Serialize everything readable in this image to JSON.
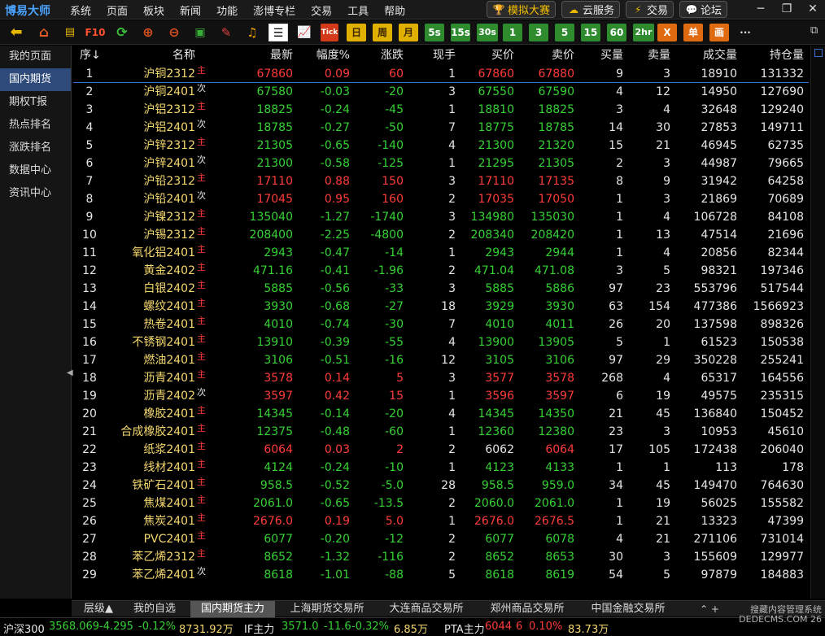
{
  "app": {
    "title": "博易大师"
  },
  "menu": [
    "系统",
    "页面",
    "板块",
    "新闻",
    "功能",
    "澎博专栏",
    "交易",
    "工具",
    "帮助"
  ],
  "quick_buttons": [
    {
      "label": "模拟大赛",
      "icon": "trophy-icon"
    },
    {
      "label": "云服务",
      "icon": "cloud-icon"
    },
    {
      "label": "交易",
      "icon": "lightning-icon"
    },
    {
      "label": "论坛",
      "icon": "chat-bubble-icon"
    }
  ],
  "toolbar": {
    "f10": "F10",
    "tick": "Tick",
    "periods": [
      "日",
      "周",
      "月",
      "5s",
      "15s",
      "30s",
      "1",
      "3",
      "5",
      "15",
      "60",
      "2hr"
    ],
    "x_label": "X",
    "dan": "单",
    "hua": "画",
    "more": "···"
  },
  "sidebar": {
    "items": [
      "我的页面",
      "国内期货",
      "期权T报",
      "热点排名",
      "涨跌排名",
      "数据中心",
      "资讯中心"
    ],
    "active_index": 1
  },
  "table": {
    "headers": [
      "序↓",
      "名称",
      "最新",
      "幅度%",
      "涨跌",
      "现手",
      "买价",
      "卖价",
      "买量",
      "卖量",
      "成交量",
      "持仓量"
    ],
    "tags": {
      "main": "主",
      "sub": "次"
    },
    "rows": [
      [
        "1",
        "沪铜2312",
        "main",
        "67860",
        "0.09",
        "60",
        "1",
        "67860",
        "67880",
        "9",
        "3",
        "18910",
        "131332",
        "up"
      ],
      [
        "2",
        "沪铜2401",
        "sub",
        "67580",
        "-0.03",
        "-20",
        "3",
        "67550",
        "67590",
        "4",
        "12",
        "14950",
        "127690",
        "dn"
      ],
      [
        "3",
        "沪铝2312",
        "main",
        "18825",
        "-0.24",
        "-45",
        "1",
        "18810",
        "18825",
        "3",
        "4",
        "32648",
        "129240",
        "dn"
      ],
      [
        "4",
        "沪铝2401",
        "sub",
        "18785",
        "-0.27",
        "-50",
        "7",
        "18775",
        "18785",
        "14",
        "30",
        "27853",
        "149711",
        "dn"
      ],
      [
        "5",
        "沪锌2312",
        "main",
        "21305",
        "-0.65",
        "-140",
        "4",
        "21300",
        "21320",
        "15",
        "21",
        "46945",
        "62735",
        "dn"
      ],
      [
        "6",
        "沪锌2401",
        "sub",
        "21300",
        "-0.58",
        "-125",
        "1",
        "21295",
        "21305",
        "2",
        "3",
        "44987",
        "79665",
        "dn"
      ],
      [
        "7",
        "沪铅2312",
        "main",
        "17110",
        "0.88",
        "150",
        "3",
        "17110",
        "17135",
        "8",
        "9",
        "31942",
        "64258",
        "up"
      ],
      [
        "8",
        "沪铅2401",
        "sub",
        "17045",
        "0.95",
        "160",
        "2",
        "17035",
        "17050",
        "1",
        "3",
        "21869",
        "70689",
        "up"
      ],
      [
        "9",
        "沪镍2312",
        "main",
        "135040",
        "-1.27",
        "-1740",
        "3",
        "134980",
        "135030",
        "1",
        "4",
        "106728",
        "84108",
        "dn"
      ],
      [
        "10",
        "沪锡2312",
        "main",
        "208400",
        "-2.25",
        "-4800",
        "2",
        "208340",
        "208420",
        "1",
        "13",
        "47514",
        "21696",
        "dn"
      ],
      [
        "11",
        "氧化铝2401",
        "main",
        "2943",
        "-0.47",
        "-14",
        "1",
        "2943",
        "2944",
        "1",
        "4",
        "20856",
        "82344",
        "dn"
      ],
      [
        "12",
        "黄金2402",
        "main",
        "471.16",
        "-0.41",
        "-1.96",
        "2",
        "471.04",
        "471.08",
        "3",
        "5",
        "98321",
        "197346",
        "dn"
      ],
      [
        "13",
        "白银2402",
        "main",
        "5885",
        "-0.56",
        "-33",
        "3",
        "5885",
        "5886",
        "97",
        "23",
        "553796",
        "517544",
        "dn"
      ],
      [
        "14",
        "螺纹2401",
        "main",
        "3930",
        "-0.68",
        "-27",
        "18",
        "3929",
        "3930",
        "63",
        "154",
        "477386",
        "1566923",
        "dn"
      ],
      [
        "15",
        "热卷2401",
        "main",
        "4010",
        "-0.74",
        "-30",
        "7",
        "4010",
        "4011",
        "26",
        "20",
        "137598",
        "898326",
        "dn"
      ],
      [
        "16",
        "不锈钢2401",
        "main",
        "13910",
        "-0.39",
        "-55",
        "4",
        "13900",
        "13905",
        "5",
        "1",
        "61523",
        "150538",
        "dn"
      ],
      [
        "17",
        "燃油2401",
        "main",
        "3106",
        "-0.51",
        "-16",
        "12",
        "3105",
        "3106",
        "97",
        "29",
        "350228",
        "255241",
        "dn"
      ],
      [
        "18",
        "沥青2401",
        "main",
        "3578",
        "0.14",
        "5",
        "3",
        "3577",
        "3578",
        "268",
        "4",
        "65317",
        "164556",
        "up"
      ],
      [
        "19",
        "沥青2402",
        "sub",
        "3597",
        "0.42",
        "15",
        "1",
        "3596",
        "3597",
        "6",
        "19",
        "49575",
        "235315",
        "up"
      ],
      [
        "20",
        "橡胶2401",
        "main",
        "14345",
        "-0.14",
        "-20",
        "4",
        "14345",
        "14350",
        "21",
        "45",
        "136840",
        "150452",
        "dn"
      ],
      [
        "21",
        "合成橡胶2401",
        "main",
        "12375",
        "-0.48",
        "-60",
        "1",
        "12360",
        "12380",
        "23",
        "3",
        "10953",
        "45610",
        "dn"
      ],
      [
        "22",
        "纸浆2401",
        "main",
        "6064",
        "0.03",
        "2",
        "2",
        "6062",
        "6064",
        "17",
        "105",
        "172438",
        "206040",
        "up"
      ],
      [
        "23",
        "线材2401",
        "main",
        "4124",
        "-0.24",
        "-10",
        "1",
        "4123",
        "4133",
        "1",
        "1",
        "113",
        "178",
        "dn"
      ],
      [
        "24",
        "铁矿石2401",
        "main",
        "958.5",
        "-0.52",
        "-5.0",
        "28",
        "958.5",
        "959.0",
        "34",
        "45",
        "149470",
        "764630",
        "dn"
      ],
      [
        "25",
        "焦煤2401",
        "main",
        "2061.0",
        "-0.65",
        "-13.5",
        "2",
        "2060.0",
        "2061.0",
        "1",
        "19",
        "56025",
        "155582",
        "dn"
      ],
      [
        "26",
        "焦炭2401",
        "main",
        "2676.0",
        "0.19",
        "5.0",
        "1",
        "2676.0",
        "2676.5",
        "1",
        "21",
        "13323",
        "47399",
        "up"
      ],
      [
        "27",
        "PVC2401",
        "main",
        "6077",
        "-0.20",
        "-12",
        "2",
        "6077",
        "6078",
        "4",
        "21",
        "271106",
        "731014",
        "dn"
      ],
      [
        "28",
        "苯乙烯2312",
        "main",
        "8652",
        "-1.32",
        "-116",
        "2",
        "8652",
        "8653",
        "30",
        "3",
        "155609",
        "129977",
        "dn"
      ],
      [
        "29",
        "苯乙烯2401",
        "sub",
        "8618",
        "-1.01",
        "-88",
        "5",
        "8618",
        "8619",
        "54",
        "5",
        "97879",
        "184883",
        "dn"
      ]
    ]
  },
  "bottom_tabs": {
    "tabs": [
      "层级▲",
      "我的自选",
      "国内期货主力",
      "上海期货交易所",
      "大连商品交易所",
      "郑州商品交易所",
      "中国金融交易所"
    ],
    "active_index": 2,
    "arrows": "⌃  +"
  },
  "status": {
    "hs300_label": "沪深300",
    "hs300_value": "3568.069",
    "hs300_chg": "-4.295",
    "hs300_pct": "-0.12%",
    "hs300_amount": "8731.92万",
    "if_label": "IF主力",
    "if_value": "3571.0",
    "if_chg": "-11.6",
    "if_pct": "-0.32%",
    "if_amount": "6.85万",
    "pta_label": "PTA主力",
    "pta_value": "6044",
    "pta_chg": "6",
    "pta_pct": "0.10%",
    "pta_amount": "83.73万"
  },
  "watermark": {
    "line1": "搜藏内容管理系统",
    "line2": "DEDECMS.COM 26"
  },
  "colors": {
    "up": "#ff3b3b",
    "down": "#35d135",
    "name": "#f5d76e",
    "accent": "#3a6fd0"
  }
}
